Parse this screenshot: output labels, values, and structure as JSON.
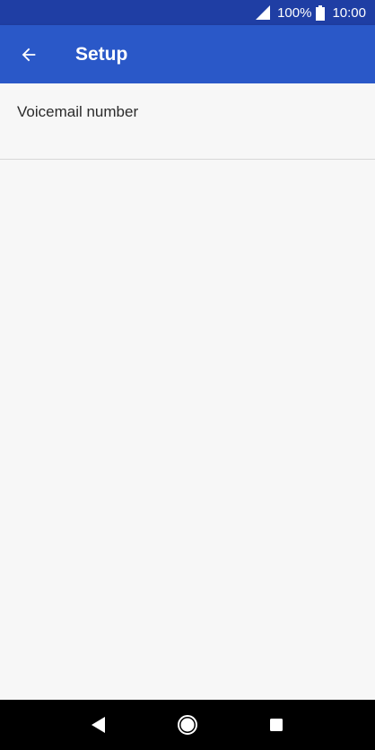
{
  "status_bar": {
    "battery_percent": "100%",
    "time": "10:00",
    "signal_icon": "signal-icon",
    "battery_icon": "battery-icon"
  },
  "app_bar": {
    "title": "Setup",
    "back_icon": "arrow-back-icon",
    "color": "#2a58c8"
  },
  "settings": {
    "items": [
      {
        "label": "Voicemail number"
      }
    ]
  },
  "nav_bar": {
    "back": "nav-back-icon",
    "home": "nav-home-icon",
    "recents": "nav-recents-icon"
  }
}
